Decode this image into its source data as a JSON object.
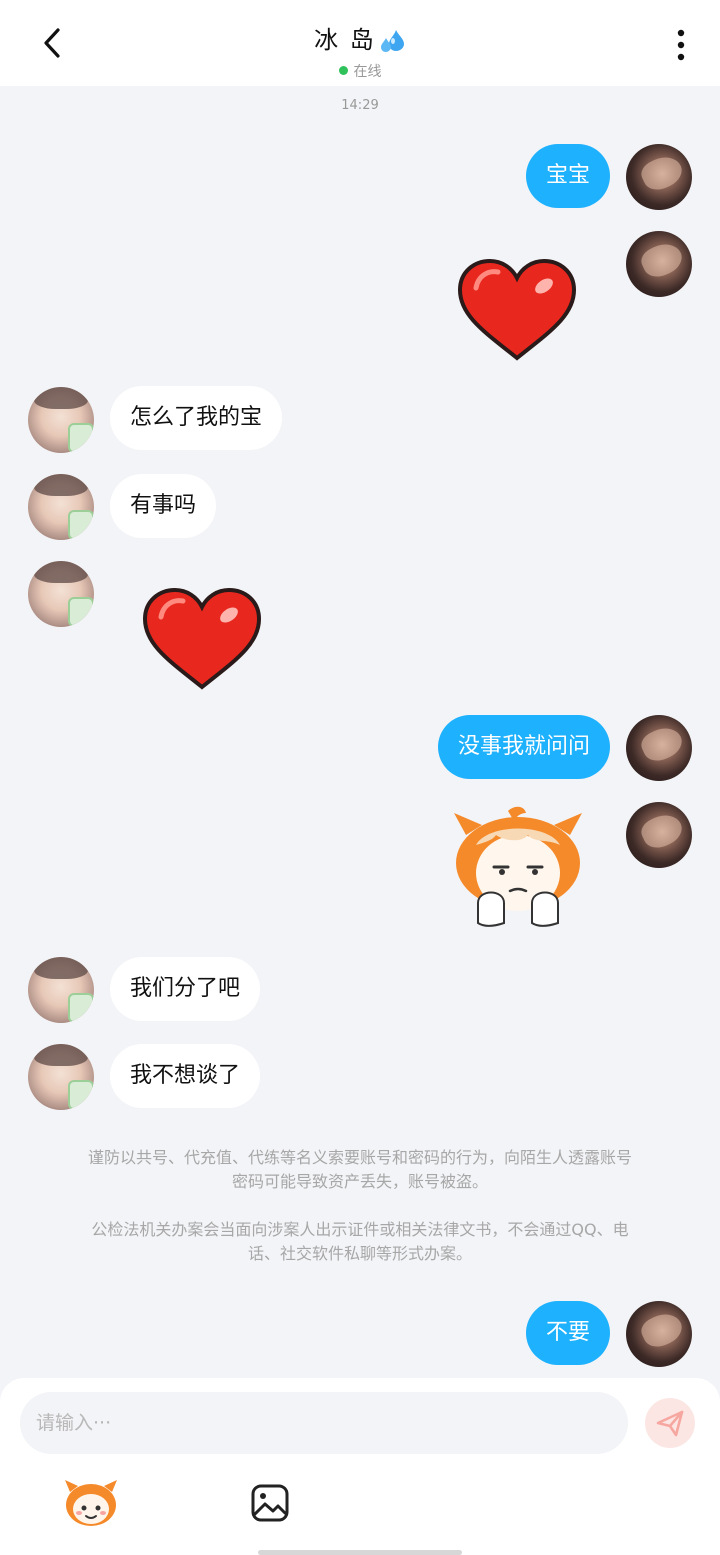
{
  "header": {
    "title": "冰 岛",
    "title_emoji": "sweat-droplets",
    "status": "在线",
    "status_color": "#2fc25b"
  },
  "timestamp": "14:29",
  "messages": [
    {
      "from": "me",
      "type": "text",
      "text": "宝宝"
    },
    {
      "from": "me",
      "type": "sticker",
      "sticker": "red-heart"
    },
    {
      "from": "her",
      "type": "text",
      "text": "怎么了我的宝"
    },
    {
      "from": "her",
      "type": "text",
      "text": "有事吗"
    },
    {
      "from": "her",
      "type": "sticker",
      "sticker": "red-heart"
    },
    {
      "from": "me",
      "type": "text",
      "text": "没事我就问问"
    },
    {
      "from": "me",
      "type": "sticker",
      "sticker": "cartoon-fox-girl"
    },
    {
      "from": "her",
      "type": "text",
      "text": "我们分了吧"
    },
    {
      "from": "her",
      "type": "text",
      "text": "我不想谈了"
    },
    {
      "from": "me",
      "type": "text",
      "text": "不要"
    }
  ],
  "notice": {
    "line1": "谨防以共号、代充值、代练等名义索要账号和密码的行为，向陌生人透露账号",
    "line2": "密码可能导致资产丢失，账号被盗。",
    "line3": "公检法机关办案会当面向涉案人出示证件或相关法律文书，不会通过QQ、电",
    "line4": "话、社交软件私聊等形式办案。"
  },
  "composer": {
    "placeholder": "请输入···",
    "value": "",
    "send_icon": "paper-plane"
  },
  "toolbar": {
    "emoji_icon": "cartoon-face",
    "image_icon": "image"
  },
  "colors": {
    "my_bubble": "#1eb1fe",
    "her_bubble": "#ffffff",
    "background": "#f3f4f7"
  }
}
